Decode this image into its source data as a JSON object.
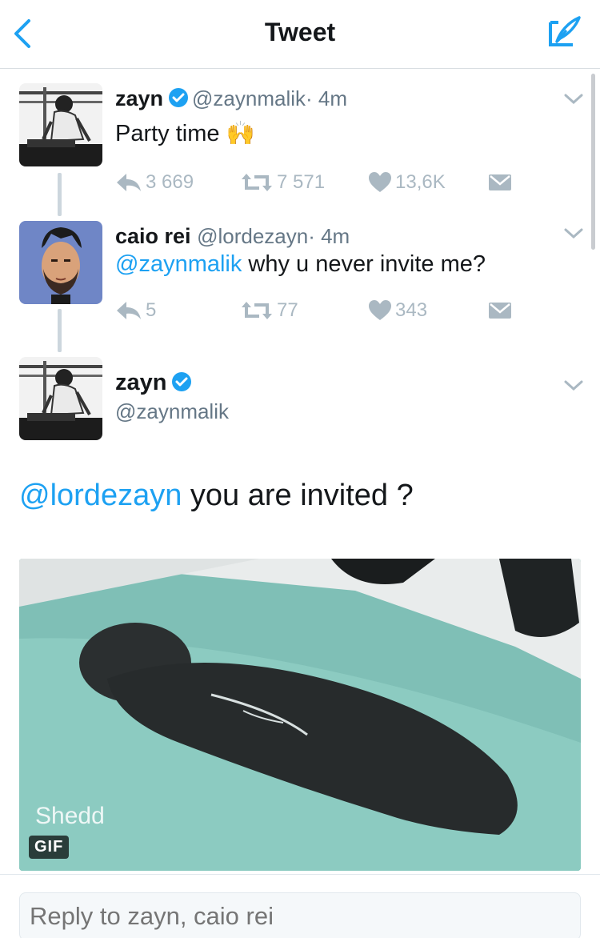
{
  "nav": {
    "title": "Tweet"
  },
  "tweet1": {
    "name": "zayn",
    "handle": "@zaynmalik",
    "time": "· 4m",
    "text": "Party time",
    "emoji": "🙌",
    "replies": "3 669",
    "retweets": "7 571",
    "likes": "13,6K"
  },
  "tweet2": {
    "name": "caio rei",
    "handle": "@lordezayn",
    "time": "· 4m",
    "mention": "@zaynmalik",
    "text": " why u never invite me?",
    "replies": "5",
    "retweets": "77",
    "likes": "343"
  },
  "main": {
    "name": "zayn",
    "handle": "@zaynmalik",
    "mention": "@lordezayn",
    "text": " you are invited ?",
    "media_badge": "GIF",
    "media_watermark": "Shedd"
  },
  "reply": {
    "placeholder": "Reply to zayn, caio rei"
  },
  "colors": {
    "accent": "#1da1f2",
    "muted": "#aab8c2",
    "text": "#14171a"
  },
  "icons": [
    "back-chevron-icon",
    "compose-icon",
    "verified-icon",
    "reply-icon",
    "retweet-icon",
    "like-icon",
    "dm-icon",
    "chevron-down-icon"
  ]
}
